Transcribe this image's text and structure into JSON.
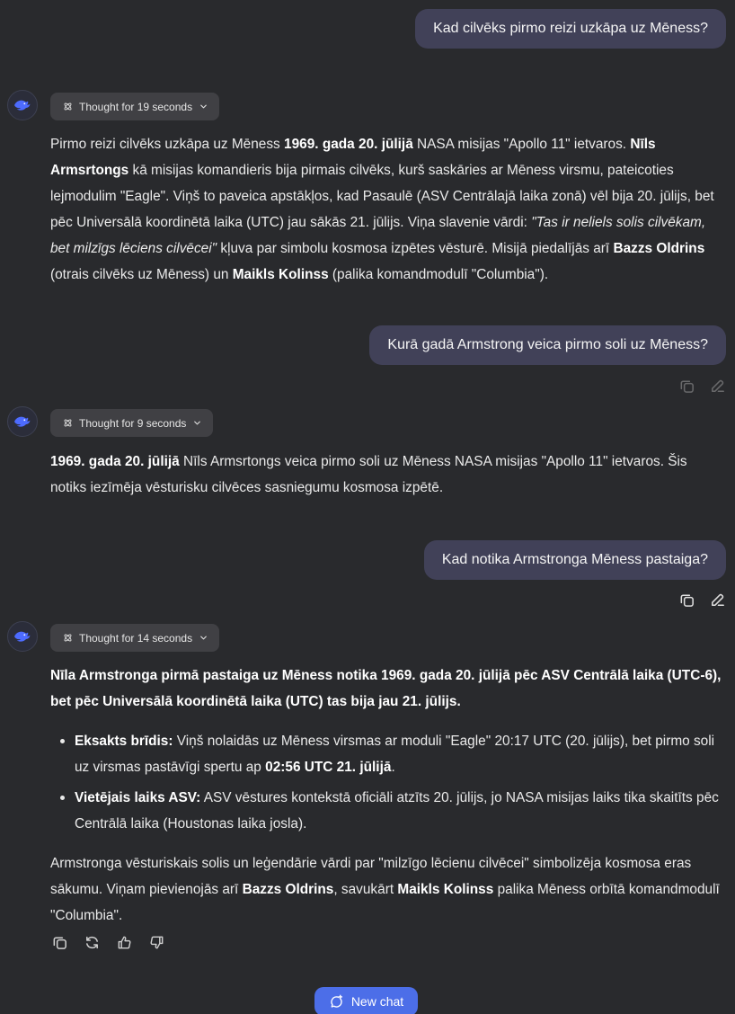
{
  "conversation": {
    "q1": "Kad cilvēks pirmo reizi uzkāpa uz Mēness?",
    "a1": {
      "thought": "Thought for 19 seconds",
      "p_html": "Pirmo reizi cilvēks uzkāpa uz Mēness <b>1969. gada 20. jūlijā</b> NASA misijas \"Apollo 11\" ietvaros. <b>Nīls Armsrtongs</b> kā misijas komandieris bija pirmais cilvēks, kurš saskāries ar Mēness virsmu, pateicoties lejmodulim \"Eagle\". Viņš to paveica apstākļos, kad Pasaulē (ASV Centrālajā laika zonā) vēl bija 20. jūlijs, bet pēc Universālā koordinētā laika (UTC) jau sākās 21. jūlijs. Viņa slavenie vārdi: <i>\"Tas ir neliels solis cilvēkam, bet milzīgs lēciens cilvēcei\"</i> kļuva par simbolu kosmosa izpētes vēsturē. Misijā piedalījās arī <b>Bazzs Oldrins</b> (otrais cilvēks uz Mēness) un <b>Maikls Kolinss</b> (palika komandmodulī \"Columbia\")."
    },
    "q2": "Kurā gadā Armstrong veica pirmo soli uz Mēness?",
    "a2": {
      "thought": "Thought for 9 seconds",
      "p_html": "<b>1969. gada 20. jūlijā</b> Nīls Armsrtongs veica pirmo soli uz Mēness NASA misijas \"Apollo 11\" ietvaros. Šis notiks iezīmēja vēsturisku cilvēces sasniegumu kosmosa izpētē."
    },
    "q3": "Kad notika Armstronga Mēness pastaiga?",
    "a3": {
      "thought": "Thought for 14 seconds",
      "intro_html": "<b>Nīla Armstronga pirmā pastaiga uz Mēness notika 1969. gada 20. jūlijā pēc ASV Centrālā laika (UTC-6), bet pēc Universālā koordinētā laika (UTC) tas bija jau 21. jūlijs.</b>",
      "bullet1_html": "<b>Eksakts brīdis:</b> Viņš nolaidās uz Mēness virsmas ar moduli \"Eagle\" 20:17 UTC (20. jūlijs), bet pirmo soli uz virsmas pastāvīgi spertu ap <b>02:56 UTC 21. jūlijā</b>.",
      "bullet2_html": "<b>Vietējais laiks ASV:</b> ASV vēstures kontekstā oficiāli atzīts 20. jūlijs, jo NASA misijas laiks tika skaitīts pēc Centrālā laika (Houstonas laika josla).",
      "outro_html": "Armstronga vēsturiskais solis un leģendārie vārdi par \"milzīgo lēcienu cilvēcei\" simbolizēja kosmosa eras sākumu. Viņam pievienojās arī <b>Bazzs Oldrins</b>, savukārt <b>Maikls Kolinss</b> palika Mēness orbītā komandmodulī \"Columbia\"."
    }
  },
  "new_chat_label": "New chat",
  "icons": {
    "assistant": "deepseek-whale-icon",
    "thought": "atom-icon",
    "chevron": "chevron-down-icon",
    "copy": "copy-icon",
    "edit": "pencil-icon",
    "regenerate": "refresh-icon",
    "like": "thumbs-up-icon",
    "dislike": "thumbs-down-icon",
    "new_chat": "chat-bubble-plus-icon"
  },
  "colors": {
    "background": "#292a2d",
    "user_bubble": "#414158",
    "thought_chip": "#404044",
    "accent": "#4c6ee8",
    "assistant_icon": "#4d6bfe"
  }
}
